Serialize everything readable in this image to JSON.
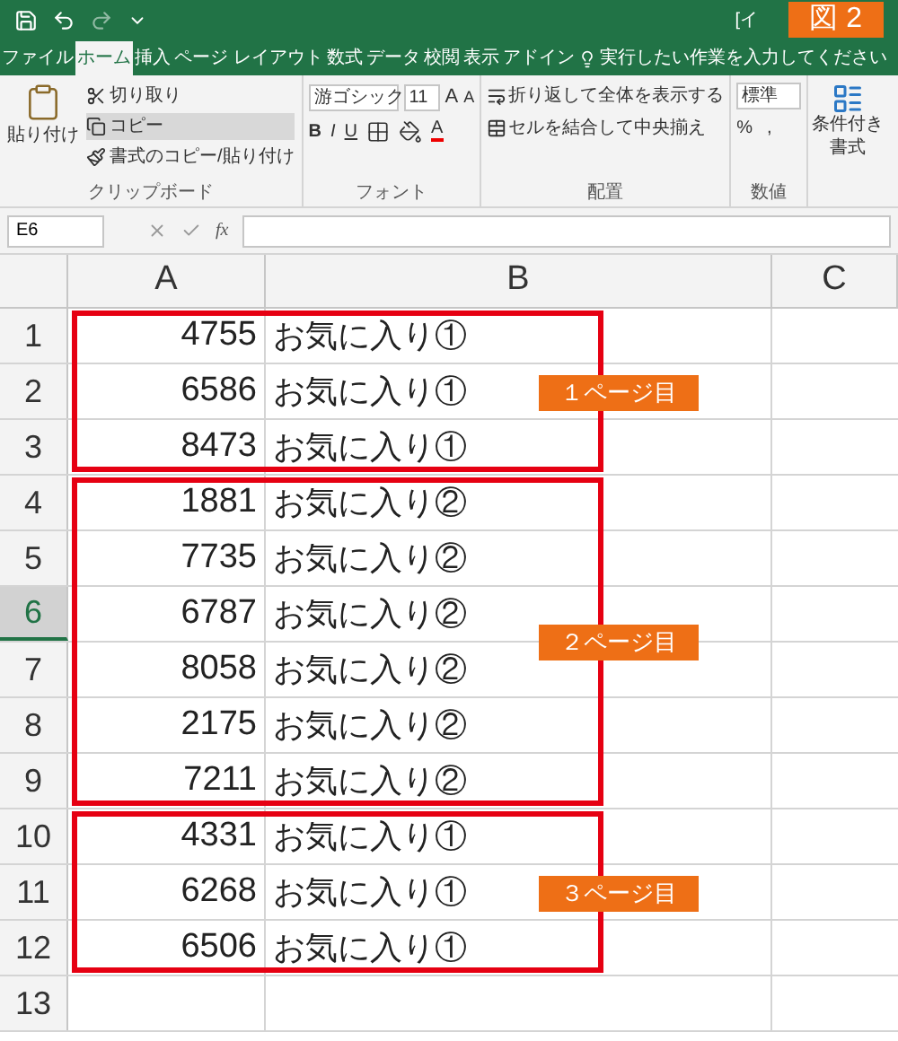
{
  "title_bar": {
    "text_fragment": "[イ"
  },
  "figure_badge": "図 2",
  "ribbon_tabs": [
    {
      "label": "ファイル",
      "selected": false
    },
    {
      "label": "ホーム",
      "selected": true
    },
    {
      "label": "挿入",
      "selected": false
    },
    {
      "label": "ページ レイアウト",
      "selected": false
    },
    {
      "label": "数式",
      "selected": false
    },
    {
      "label": "データ",
      "selected": false
    },
    {
      "label": "校閲",
      "selected": false
    },
    {
      "label": "表示",
      "selected": false
    },
    {
      "label": "アドイン",
      "selected": false
    }
  ],
  "tell_me": "実行したい作業を入力してください",
  "clipboard": {
    "paste": "貼り付け",
    "cut": "切り取り",
    "copy": "コピー",
    "format_painter": "書式のコピー/貼り付け",
    "label": "クリップボード"
  },
  "font": {
    "font_name": "游ゴシック",
    "font_size": "11",
    "grow": "A",
    "shrink": "A",
    "bold": "B",
    "italic": "I",
    "underline": "U",
    "color_letter": "A",
    "label": "フォント"
  },
  "alignment": {
    "wrap_text": "折り返して全体を表示する",
    "merge_center": "セルを結合して中央揃え",
    "label": "配置"
  },
  "number": {
    "format": "標準",
    "percent": "%",
    "comma": ",",
    "label": "数値"
  },
  "styles": {
    "conditional_formatting": "条件付き書式"
  },
  "name_box": "E6",
  "formula_fx": "fx",
  "columns": [
    "A",
    "B",
    "C"
  ],
  "pages": [
    {
      "label": "１ページ目",
      "rows": [
        {
          "header": "1",
          "a": "4755",
          "b": "お気に入り①",
          "selected": false
        },
        {
          "header": "2",
          "a": "6586",
          "b": "お気に入り①",
          "selected": false
        },
        {
          "header": "3",
          "a": "8473",
          "b": "お気に入り①",
          "selected": false
        }
      ]
    },
    {
      "label": "２ページ目",
      "rows": [
        {
          "header": "4",
          "a": "1881",
          "b": "お気に入り②",
          "selected": false
        },
        {
          "header": "5",
          "a": "7735",
          "b": "お気に入り②",
          "selected": false
        },
        {
          "header": "6",
          "a": "6787",
          "b": "お気に入り②",
          "selected": true
        },
        {
          "header": "7",
          "a": "8058",
          "b": "お気に入り②",
          "selected": false
        },
        {
          "header": "8",
          "a": "2175",
          "b": "お気に入り②",
          "selected": false
        },
        {
          "header": "9",
          "a": "7211",
          "b": "お気に入り②",
          "selected": false
        }
      ]
    },
    {
      "label": "３ページ目",
      "rows": [
        {
          "header": "10",
          "a": "4331",
          "b": "お気に入り①",
          "selected": false
        },
        {
          "header": "11",
          "a": "6268",
          "b": "お気に入り①",
          "selected": false
        },
        {
          "header": "12",
          "a": "6506",
          "b": "お気に入り①",
          "selected": false
        }
      ]
    }
  ],
  "empty_rows": [
    {
      "header": "13",
      "selected": false
    }
  ]
}
